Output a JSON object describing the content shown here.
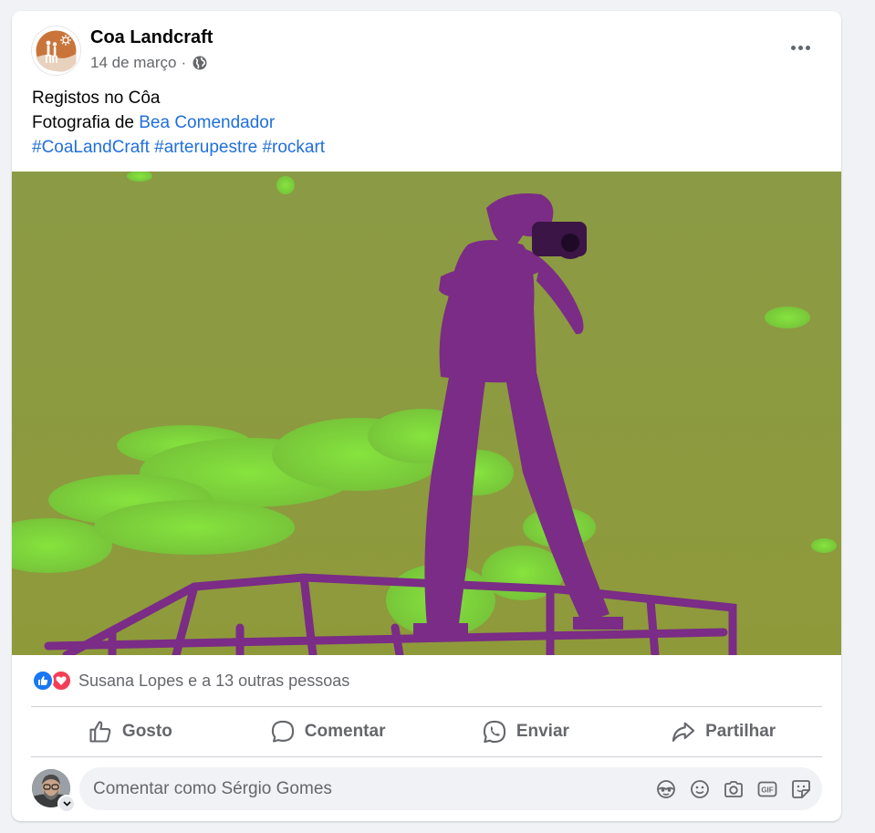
{
  "post": {
    "page_name": "Coa Landcraft",
    "date": "14 de março",
    "separator": "·",
    "privacy_icon": "globe-icon",
    "more_icon": "more-options-icon",
    "text_line1": "Registos no Côa",
    "photo_credit_prefix": "Fotografia de ",
    "photo_credit_name": "Bea Comendador",
    "hashtags": [
      "#CoaLandCraft",
      "#arterupestre",
      "#rockart"
    ]
  },
  "reactions": {
    "icons": [
      "like-icon",
      "love-icon"
    ],
    "summary": "Susana Lopes e a 13 outras pessoas"
  },
  "actions": {
    "like": "Gosto",
    "comment": "Comentar",
    "send": "Enviar",
    "share": "Partilhar"
  },
  "comment": {
    "placeholder": "Comentar como Sérgio Gomes",
    "tools": [
      "avatar-sticker-icon",
      "emoji-icon",
      "camera-icon",
      "gif-icon",
      "sticker-icon"
    ]
  },
  "colors": {
    "link": "#216fdb",
    "like": "#1877f2",
    "love": "#f33e58",
    "photo_sky": "#8a9a3c",
    "photo_cloud": "#7fdc3a",
    "photo_subject": "#7a2a8a"
  }
}
